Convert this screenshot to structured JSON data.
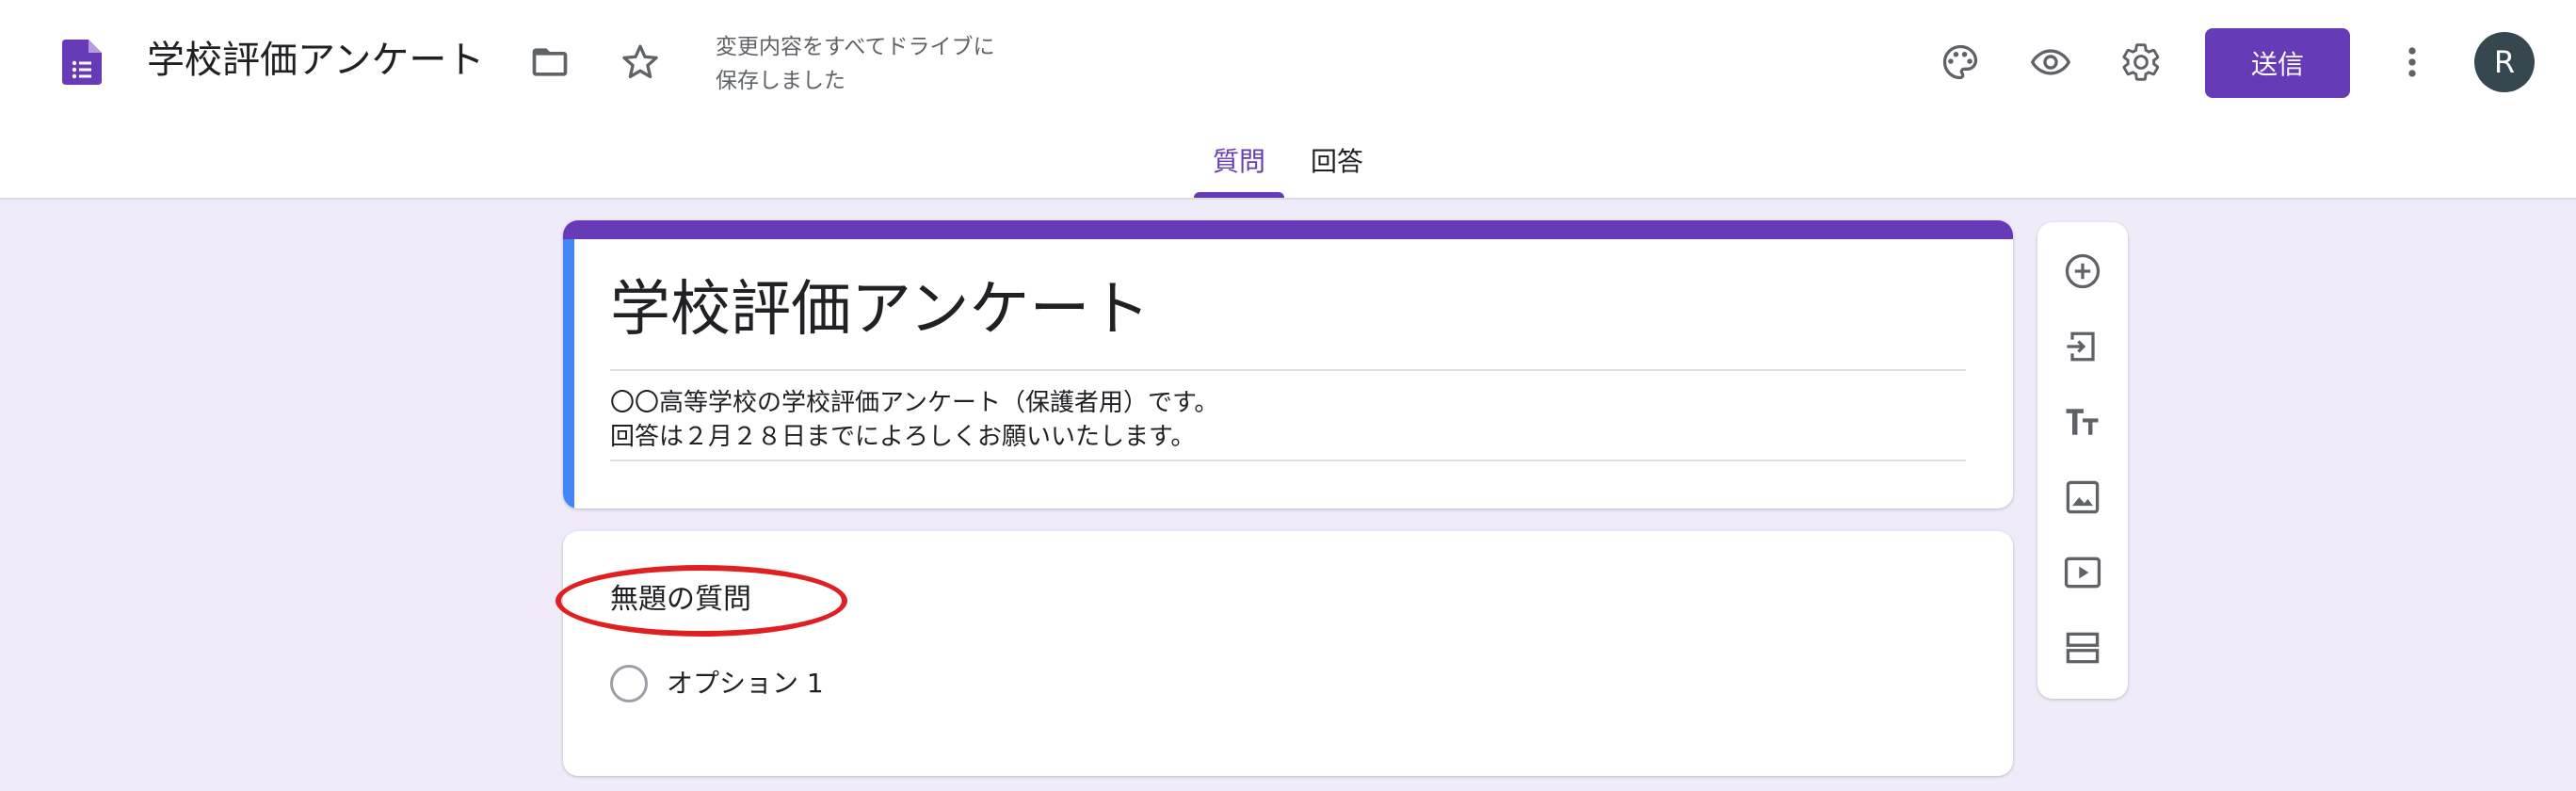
{
  "header": {
    "doc_title": "学校評価アンケート",
    "save_status_line1": "変更内容をすべてドライブに",
    "save_status_line2": "保存しました",
    "send_label": "送信",
    "avatar_letter": "R",
    "icons": [
      "forms-doc-icon",
      "folder-icon",
      "star-icon",
      "palette-icon",
      "eye-icon",
      "gear-icon",
      "more-vert-icon"
    ]
  },
  "tabs": [
    {
      "label": "質問",
      "active": true
    },
    {
      "label": "回答",
      "active": false
    }
  ],
  "form": {
    "title": "学校評価アンケート",
    "description_line1": "〇〇高等学校の学校評価アンケート（保護者用）です。",
    "description_line2": "回答は２月２８日までによろしくお願いいたします。"
  },
  "question": {
    "title": "無題の質問",
    "option_label": "オプション 1"
  },
  "toolbar": {
    "icons": [
      "add-question-icon",
      "import-questions-icon",
      "add-title-icon",
      "add-image-icon",
      "add-video-icon",
      "add-section-icon"
    ]
  },
  "colors": {
    "accent": "#673ab7",
    "background": "#f0ebf8",
    "title_left_bar": "#4285f4",
    "annotation_oval": "#e02020"
  }
}
